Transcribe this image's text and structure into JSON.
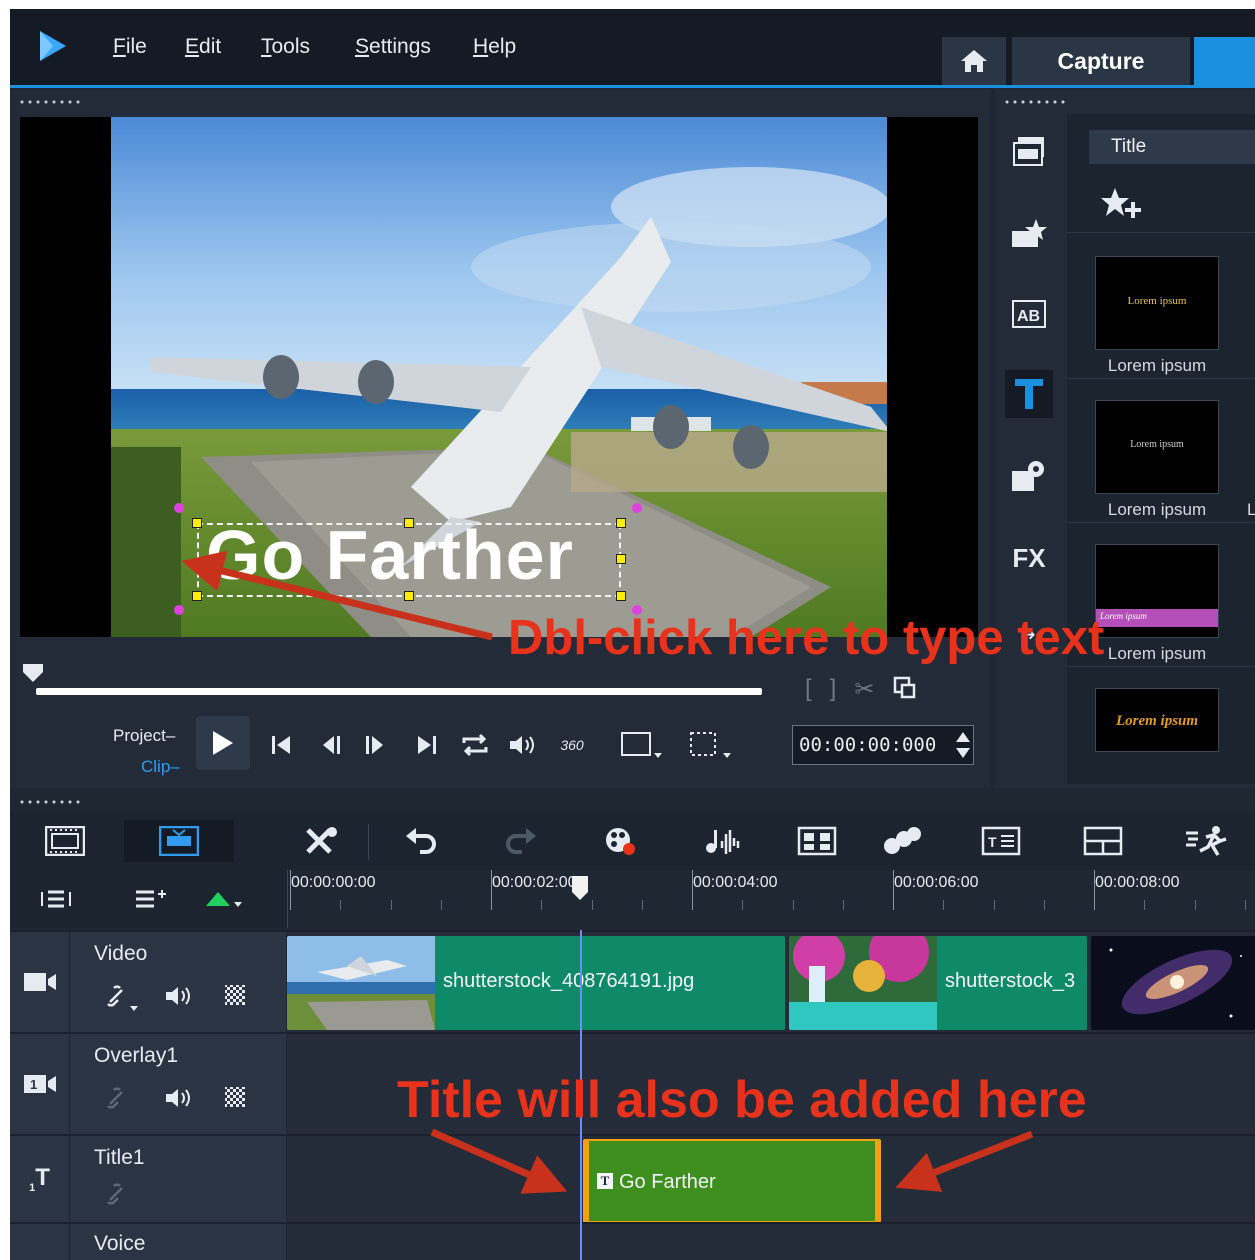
{
  "menubar": {
    "items": [
      "File",
      "Edit",
      "Tools",
      "Settings",
      "Help"
    ],
    "accel": [
      "F",
      "E",
      "T",
      "S",
      "H"
    ],
    "tabs": {
      "capture": "Capture"
    }
  },
  "preview": {
    "overlay_title": "Go Farther",
    "project_label": "Project",
    "clip_label": "Clip",
    "timecode": "00:00:00:000"
  },
  "library": {
    "category": "Title",
    "thumbs": [
      {
        "preview_text": "Lorem ipsum",
        "label": "Lorem ipsum"
      },
      {
        "preview_text": "Lorem ipsum",
        "label": "Lorem ipsum",
        "label_next": "Lo"
      },
      {
        "preview_text": "Lorem ipsum",
        "label": "Lorem ipsum"
      },
      {
        "preview_text": "Lorem ipsum"
      }
    ]
  },
  "timeline": {
    "ruler": [
      "00:00:00:00",
      "00:00:02:00",
      "00:00:04:00",
      "00:00:06:00",
      "00:00:08:00"
    ],
    "tracks": [
      {
        "name": "Video"
      },
      {
        "name": "Overlay1"
      },
      {
        "name": "Title1"
      },
      {
        "name": "Voice"
      }
    ],
    "video_clips": [
      "shutterstock_408764191.jpg",
      "shutterstock_3"
    ],
    "title_clip": "Go Farther",
    "title_track_number": "1"
  },
  "annotations": {
    "dblclick": "Dbl-click here to type text",
    "title_added": "Title will also be added here"
  },
  "colors": {
    "accent": "#1b8fe0",
    "annotation": "#e8321c",
    "video_clip": "#0f8a68",
    "title_clip": "#3f8f1e",
    "title_clip_border": "#f2a114"
  }
}
